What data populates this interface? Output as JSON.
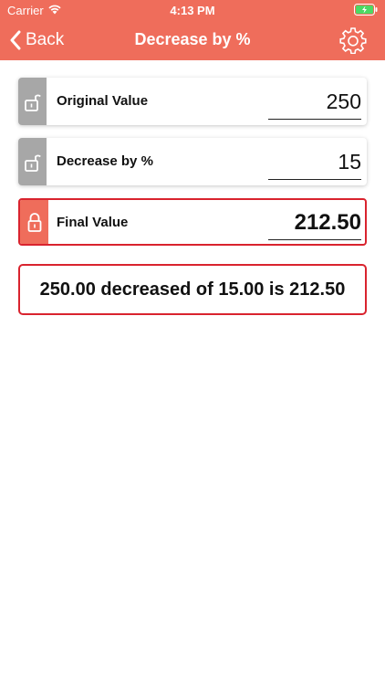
{
  "status_bar": {
    "carrier": "Carrier",
    "time": "4:13 PM",
    "wifi_icon": "wifi-icon",
    "battery_icon": "battery-charging-icon"
  },
  "nav": {
    "back_label": "Back",
    "title": "Decrease by %",
    "settings_icon": "gear-icon"
  },
  "fields": {
    "original": {
      "label": "Original Value",
      "value": "250",
      "lock_icon": "unlocked-lock-icon"
    },
    "decrease": {
      "label": "Decrease by %",
      "value": "15",
      "lock_icon": "unlocked-lock-icon"
    },
    "final": {
      "label": "Final Value",
      "value": "212.50",
      "lock_icon": "locked-lock-icon"
    }
  },
  "result": {
    "text": "250.00 decreased of 15.00 is 212.50"
  },
  "colors": {
    "header": "#ef6d5b",
    "accent_red": "#d9232e",
    "lock_gray": "#a7a7a7"
  }
}
